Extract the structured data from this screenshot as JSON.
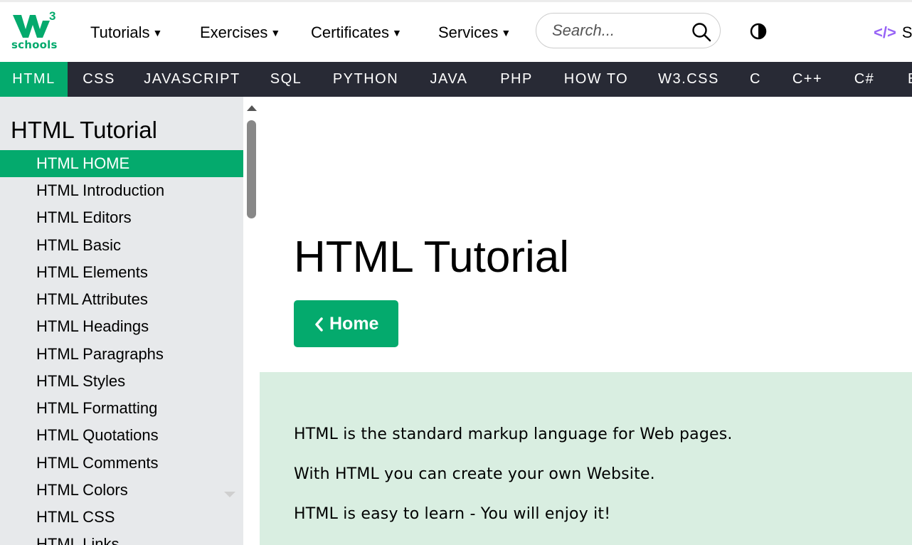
{
  "brand": {
    "logo_text": "schools",
    "logo_superscript": "3",
    "logo_icon": "w3schools-logo-icon",
    "color": "#04AA6D"
  },
  "topnav": {
    "items": [
      {
        "label": "Tutorials"
      },
      {
        "label": "Exercises"
      },
      {
        "label": "Certificates"
      },
      {
        "label": "Services"
      }
    ],
    "search_placeholder": "Search...",
    "spaces_label": "S"
  },
  "subnav": {
    "tabs": [
      {
        "label": "HTML"
      },
      {
        "label": "CSS"
      },
      {
        "label": "JAVASCRIPT"
      },
      {
        "label": "SQL"
      },
      {
        "label": "PYTHON"
      },
      {
        "label": "JAVA"
      },
      {
        "label": "PHP"
      },
      {
        "label": "HOW TO"
      },
      {
        "label": "W3.CSS"
      },
      {
        "label": "C"
      },
      {
        "label": "C++"
      },
      {
        "label": "C#"
      },
      {
        "label": "B"
      }
    ],
    "active_tab": "HTML"
  },
  "sidebar": {
    "title": "HTML Tutorial",
    "items": [
      {
        "label": "HTML HOME"
      },
      {
        "label": "HTML Introduction"
      },
      {
        "label": "HTML Editors"
      },
      {
        "label": "HTML Basic"
      },
      {
        "label": "HTML Elements"
      },
      {
        "label": "HTML Attributes"
      },
      {
        "label": "HTML Headings"
      },
      {
        "label": "HTML Paragraphs"
      },
      {
        "label": "HTML Styles"
      },
      {
        "label": "HTML Formatting"
      },
      {
        "label": "HTML Quotations"
      },
      {
        "label": "HTML Comments"
      },
      {
        "label": "HTML Colors"
      },
      {
        "label": "HTML CSS"
      },
      {
        "label": "HTML Links"
      }
    ],
    "active_item": "HTML HOME"
  },
  "main": {
    "title": "HTML Tutorial",
    "home_button": "Home",
    "intro": [
      "HTML is the standard markup language for Web pages.",
      "With HTML you can create your own Website.",
      "HTML is easy to learn - You will enjoy it!"
    ]
  },
  "colors": {
    "accent": "#04AA6D",
    "subnav_bg": "#282A35",
    "sidebar_bg": "#E7E9EB",
    "intro_bg": "#D9EEE1",
    "spaces_icon": "#9763f6"
  }
}
